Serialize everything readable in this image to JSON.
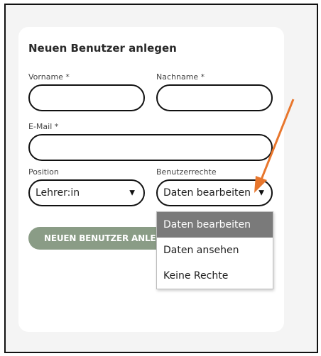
{
  "form": {
    "title": "Neuen Benutzer anlegen",
    "vorname_label": "Vorname *",
    "nachname_label": "Nachname *",
    "email_label": "E-Mail *",
    "position_label": "Position",
    "rights_label": "Benutzerrechte",
    "vorname_value": "",
    "nachname_value": "",
    "email_value": "",
    "position_selected": "Lehrer:in",
    "rights_selected": "Daten bearbeiten",
    "submit_label": "NEUEN BENUTZER ANLEGEN"
  },
  "rights_dropdown": {
    "options": [
      "Daten bearbeiten",
      "Daten ansehen",
      "Keine Rechte"
    ],
    "highlighted": "Daten bearbeiten"
  },
  "colors": {
    "button_bg": "#8a9c86",
    "highlight_bg": "#7a7a7a",
    "arrow": "#e8762c"
  },
  "icons": {
    "caret": "caret-down-icon",
    "annotation": "arrow-annotation-icon"
  }
}
